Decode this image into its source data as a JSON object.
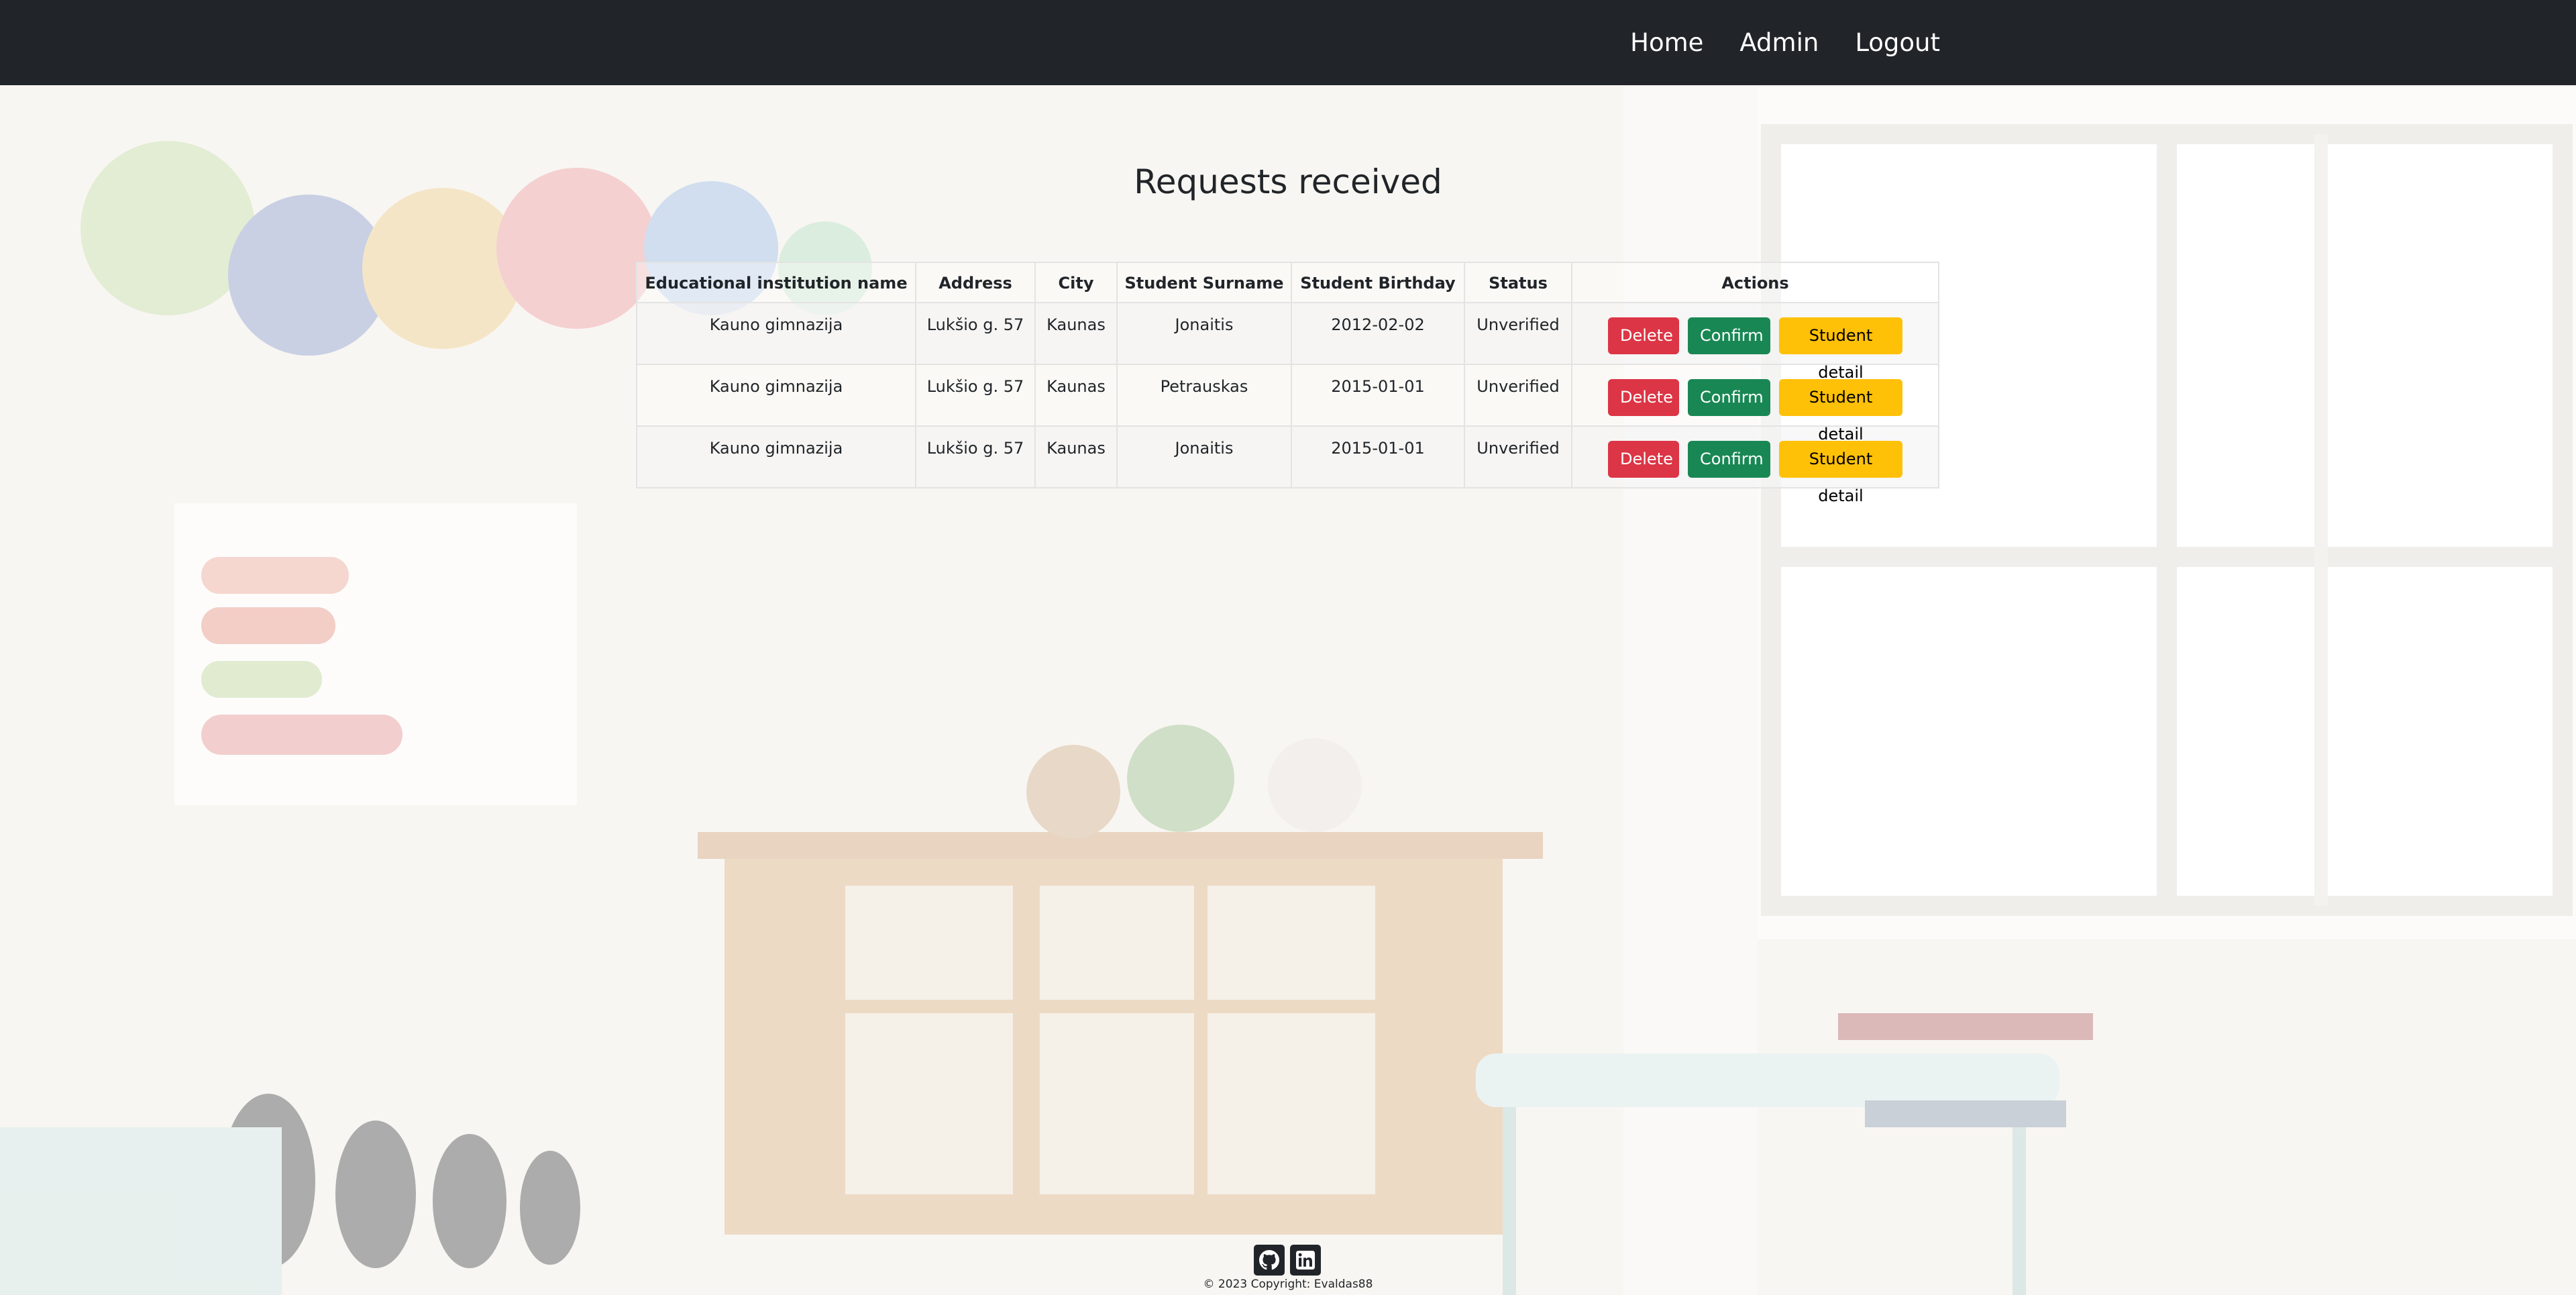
{
  "nav": {
    "links": [
      "Home",
      "Admin",
      "Logout"
    ]
  },
  "page": {
    "title": "Requests received"
  },
  "table": {
    "headers": [
      "Educational institution name",
      "Address",
      "City",
      "Student Surname",
      "Student Birthday",
      "Status",
      "Actions"
    ],
    "rows": [
      {
        "institution": "Kauno gimnazija",
        "address": "Lukšio g. 57",
        "city": "Kaunas",
        "surname": "Jonaitis",
        "birthday": "2012-02-02",
        "status": "Unverified"
      },
      {
        "institution": "Kauno gimnazija",
        "address": "Lukšio g. 57",
        "city": "Kaunas",
        "surname": "Petrauskas",
        "birthday": "2015-01-01",
        "status": "Unverified"
      },
      {
        "institution": "Kauno gimnazija",
        "address": "Lukšio g. 57",
        "city": "Kaunas",
        "surname": "Jonaitis",
        "birthday": "2015-01-01",
        "status": "Unverified"
      }
    ],
    "actions": {
      "delete": "Delete",
      "confirm": "Confirm",
      "detail": "Student detail"
    }
  },
  "footer": {
    "icons": [
      "github-icon",
      "linkedin-icon"
    ],
    "copyright": "© 2023 Copyright: Evaldas88"
  },
  "colors": {
    "navbar": "#212529",
    "delete": "#dc3545",
    "confirm": "#198754",
    "detail": "#ffc107"
  }
}
